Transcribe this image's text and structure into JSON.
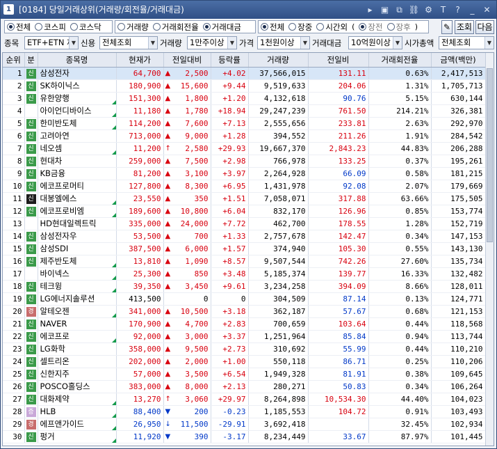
{
  "window": {
    "number": "1",
    "title": "[0184] 당일거래상위(거래량/회전율/거래대금)"
  },
  "toolbar_icons": [
    "nav-arrow-icon",
    "window-icon",
    "copy-icon",
    "link-icon",
    "settings-icon",
    "text-icon",
    "help-icon",
    "minimize-icon",
    "close-icon"
  ],
  "market_filter": {
    "options": [
      "전체",
      "코스피",
      "코스닥"
    ],
    "selected": "전체"
  },
  "sort_filter": {
    "options": [
      "거래량",
      "거래회전율",
      "거래대금"
    ],
    "selected": "거래대금"
  },
  "session_filter": {
    "options": [
      "전체",
      "장중",
      "시간외"
    ],
    "selected": "전체",
    "sub_options": [
      "장전",
      "장후"
    ]
  },
  "buttons": {
    "query": "조회",
    "next": "다음"
  },
  "filters": {
    "stock_label": "종목",
    "stock_value": "ETF+ETN 제",
    "credit_label": "신용",
    "credit_value": "전체조회",
    "volume_label": "거래량",
    "volume_value": "1만주이상",
    "price_label": "가격",
    "price_value": "1천원이상",
    "amount_label": "거래대금",
    "amount_value": "10억원이상",
    "mcap_label": "시가총액",
    "mcap_value": "전체조회"
  },
  "columns": [
    "순위",
    "분",
    "종목명",
    "현재가",
    "전일대비",
    "등락률",
    "거래량",
    "전일비",
    "거래회전율",
    "금액(백만)"
  ],
  "colors": {
    "up": "#d8000f",
    "down": "#0038c8",
    "title_bar": "#2f4f86",
    "selected_row": "#d7e6f7"
  },
  "rows": [
    {
      "rank": "1",
      "badge": "신",
      "bc": "g",
      "name": "삼성전자",
      "flag": false,
      "price": "64,700",
      "dir": "up",
      "arrow": "▲",
      "change": "2,500",
      "rate": "+4.02",
      "volume": "37,566,015",
      "prev_ratio": "131.11",
      "pr_dir": "up",
      "turnover": "0.63%",
      "amount": "2,417,513"
    },
    {
      "rank": "2",
      "badge": "신",
      "bc": "g",
      "name": "SK하이닉스",
      "flag": false,
      "price": "180,900",
      "dir": "up",
      "arrow": "▲",
      "change": "15,600",
      "rate": "+9.44",
      "volume": "9,519,633",
      "prev_ratio": "204.06",
      "pr_dir": "up",
      "turnover": "1.31%",
      "amount": "1,705,713"
    },
    {
      "rank": "3",
      "badge": "신",
      "bc": "g",
      "name": "유한양행",
      "flag": true,
      "price": "151,300",
      "dir": "up",
      "arrow": "▲",
      "change": "1,800",
      "rate": "+1.20",
      "volume": "4,132,618",
      "prev_ratio": "90.76",
      "pr_dir": "dn",
      "turnover": "5.15%",
      "amount": "630,144"
    },
    {
      "rank": "4",
      "badge": "",
      "bc": "",
      "name": "아이언디바이스",
      "flag": true,
      "price": "11,180",
      "dir": "up",
      "arrow": "▲",
      "change": "1,780",
      "rate": "+18.94",
      "volume": "29,247,239",
      "prev_ratio": "761.50",
      "pr_dir": "up",
      "turnover": "214.21%",
      "amount": "326,381"
    },
    {
      "rank": "5",
      "badge": "신",
      "bc": "g",
      "name": "한미반도체",
      "flag": true,
      "price": "114,200",
      "dir": "up",
      "arrow": "▲",
      "change": "7,600",
      "rate": "+7.13",
      "volume": "2,555,656",
      "prev_ratio": "233.81",
      "pr_dir": "up",
      "turnover": "2.63%",
      "amount": "292,970"
    },
    {
      "rank": "6",
      "badge": "신",
      "bc": "g",
      "name": "고려아연",
      "flag": false,
      "price": "713,000",
      "dir": "up",
      "arrow": "▲",
      "change": "9,000",
      "rate": "+1.28",
      "volume": "394,552",
      "prev_ratio": "211.26",
      "pr_dir": "up",
      "turnover": "1.91%",
      "amount": "284,542"
    },
    {
      "rank": "7",
      "badge": "신",
      "bc": "g",
      "name": "네오셈",
      "flag": true,
      "price": "11,200",
      "dir": "up",
      "arrow": "↑",
      "change": "2,580",
      "rate": "+29.93",
      "volume": "19,667,370",
      "prev_ratio": "2,843.23",
      "pr_dir": "up",
      "turnover": "44.83%",
      "amount": "206,288"
    },
    {
      "rank": "8",
      "badge": "신",
      "bc": "g",
      "name": "현대차",
      "flag": false,
      "price": "259,000",
      "dir": "up",
      "arrow": "▲",
      "change": "7,500",
      "rate": "+2.98",
      "volume": "766,978",
      "prev_ratio": "133.25",
      "pr_dir": "up",
      "turnover": "0.37%",
      "amount": "195,261"
    },
    {
      "rank": "9",
      "badge": "신",
      "bc": "g",
      "name": "KB금융",
      "flag": false,
      "price": "81,200",
      "dir": "up",
      "arrow": "▲",
      "change": "3,100",
      "rate": "+3.97",
      "volume": "2,264,928",
      "prev_ratio": "66.09",
      "pr_dir": "dn",
      "turnover": "0.58%",
      "amount": "181,215"
    },
    {
      "rank": "10",
      "badge": "신",
      "bc": "g",
      "name": "에코프로머티",
      "flag": false,
      "price": "127,800",
      "dir": "up",
      "arrow": "▲",
      "change": "8,300",
      "rate": "+6.95",
      "volume": "1,431,978",
      "prev_ratio": "92.08",
      "pr_dir": "dn",
      "turnover": "2.07%",
      "amount": "179,669"
    },
    {
      "rank": "11",
      "badge": "신",
      "bc": "k",
      "name": "대봉엘에스",
      "flag": true,
      "price": "23,550",
      "dir": "up",
      "arrow": "▲",
      "change": "350",
      "rate": "+1.51",
      "volume": "7,058,071",
      "prev_ratio": "317.88",
      "pr_dir": "up",
      "turnover": "63.66%",
      "amount": "175,505"
    },
    {
      "rank": "12",
      "badge": "신",
      "bc": "g",
      "name": "에코프로비엠",
      "flag": true,
      "price": "189,600",
      "dir": "up",
      "arrow": "▲",
      "change": "10,800",
      "rate": "+6.04",
      "volume": "832,170",
      "prev_ratio": "126.96",
      "pr_dir": "up",
      "turnover": "0.85%",
      "amount": "153,774"
    },
    {
      "rank": "13",
      "badge": "",
      "bc": "",
      "name": "HD현대일렉트릭",
      "flag": false,
      "price": "335,000",
      "dir": "up",
      "arrow": "▲",
      "change": "24,000",
      "rate": "+7.72",
      "volume": "462,700",
      "prev_ratio": "178.55",
      "pr_dir": "up",
      "turnover": "1.28%",
      "amount": "152,719"
    },
    {
      "rank": "14",
      "badge": "신",
      "bc": "g",
      "name": "삼성전자우",
      "flag": false,
      "price": "53,500",
      "dir": "up",
      "arrow": "▲",
      "change": "700",
      "rate": "+1.33",
      "volume": "2,757,678",
      "prev_ratio": "142.47",
      "pr_dir": "up",
      "turnover": "0.34%",
      "amount": "147,153"
    },
    {
      "rank": "15",
      "badge": "신",
      "bc": "g",
      "name": "삼성SDI",
      "flag": false,
      "price": "387,500",
      "dir": "up",
      "arrow": "▲",
      "change": "6,000",
      "rate": "+1.57",
      "volume": "374,940",
      "prev_ratio": "105.30",
      "pr_dir": "up",
      "turnover": "0.55%",
      "amount": "143,130"
    },
    {
      "rank": "16",
      "badge": "신",
      "bc": "g",
      "name": "제주반도체",
      "flag": true,
      "price": "13,810",
      "dir": "up",
      "arrow": "▲",
      "change": "1,090",
      "rate": "+8.57",
      "volume": "9,507,544",
      "prev_ratio": "742.26",
      "pr_dir": "up",
      "turnover": "27.60%",
      "amount": "135,734"
    },
    {
      "rank": "17",
      "badge": "",
      "bc": "",
      "name": "바이넥스",
      "flag": true,
      "price": "25,300",
      "dir": "up",
      "arrow": "▲",
      "change": "850",
      "rate": "+3.48",
      "volume": "5,185,374",
      "prev_ratio": "139.77",
      "pr_dir": "up",
      "turnover": "16.33%",
      "amount": "132,482"
    },
    {
      "rank": "18",
      "badge": "신",
      "bc": "g",
      "name": "테크윙",
      "flag": true,
      "price": "39,350",
      "dir": "up",
      "arrow": "▲",
      "change": "3,450",
      "rate": "+9.61",
      "volume": "3,234,258",
      "prev_ratio": "394.09",
      "pr_dir": "up",
      "turnover": "8.66%",
      "amount": "128,011"
    },
    {
      "rank": "19",
      "badge": "신",
      "bc": "g",
      "name": "LG에너지솔루션",
      "flag": false,
      "price": "413,500",
      "dir": "flat",
      "arrow": "",
      "change": "0",
      "rate": "0",
      "volume": "304,509",
      "prev_ratio": "87.14",
      "pr_dir": "dn",
      "turnover": "0.13%",
      "amount": "124,771"
    },
    {
      "rank": "20",
      "badge": "경",
      "bc": "r",
      "name": "알테오젠",
      "flag": true,
      "price": "341,000",
      "dir": "up",
      "arrow": "▲",
      "change": "10,500",
      "rate": "+3.18",
      "volume": "362,187",
      "prev_ratio": "57.67",
      "pr_dir": "dn",
      "turnover": "0.68%",
      "amount": "121,153"
    },
    {
      "rank": "21",
      "badge": "신",
      "bc": "g",
      "name": "NAVER",
      "flag": false,
      "price": "170,900",
      "dir": "up",
      "arrow": "▲",
      "change": "4,700",
      "rate": "+2.83",
      "volume": "700,659",
      "prev_ratio": "103.64",
      "pr_dir": "up",
      "turnover": "0.44%",
      "amount": "118,568"
    },
    {
      "rank": "22",
      "badge": "신",
      "bc": "g",
      "name": "에코프로",
      "flag": true,
      "price": "92,000",
      "dir": "up",
      "arrow": "▲",
      "change": "3,000",
      "rate": "+3.37",
      "volume": "1,251,964",
      "prev_ratio": "85.84",
      "pr_dir": "dn",
      "turnover": "0.94%",
      "amount": "113,744"
    },
    {
      "rank": "23",
      "badge": "신",
      "bc": "g",
      "name": "LG화학",
      "flag": false,
      "price": "358,000",
      "dir": "up",
      "arrow": "▲",
      "change": "9,500",
      "rate": "+2.73",
      "volume": "310,692",
      "prev_ratio": "55.99",
      "pr_dir": "dn",
      "turnover": "0.44%",
      "amount": "110,210"
    },
    {
      "rank": "24",
      "badge": "신",
      "bc": "g",
      "name": "셀트리온",
      "flag": false,
      "price": "202,000",
      "dir": "up",
      "arrow": "▲",
      "change": "2,000",
      "rate": "+1.00",
      "volume": "550,118",
      "prev_ratio": "86.71",
      "pr_dir": "dn",
      "turnover": "0.25%",
      "amount": "110,206"
    },
    {
      "rank": "25",
      "badge": "신",
      "bc": "g",
      "name": "신한지주",
      "flag": false,
      "price": "57,000",
      "dir": "up",
      "arrow": "▲",
      "change": "3,500",
      "rate": "+6.54",
      "volume": "1,949,328",
      "prev_ratio": "81.91",
      "pr_dir": "dn",
      "turnover": "0.38%",
      "amount": "109,645"
    },
    {
      "rank": "26",
      "badge": "신",
      "bc": "g",
      "name": "POSCO홀딩스",
      "flag": false,
      "price": "383,000",
      "dir": "up",
      "arrow": "▲",
      "change": "8,000",
      "rate": "+2.13",
      "volume": "280,271",
      "prev_ratio": "50.83",
      "pr_dir": "dn",
      "turnover": "0.34%",
      "amount": "106,264"
    },
    {
      "rank": "27",
      "badge": "신",
      "bc": "g",
      "name": "대화제약",
      "flag": true,
      "price": "13,270",
      "dir": "up",
      "arrow": "↑",
      "change": "3,060",
      "rate": "+29.97",
      "volume": "8,264,898",
      "prev_ratio": "10,534.30",
      "pr_dir": "up",
      "turnover": "44.40%",
      "amount": "104,023"
    },
    {
      "rank": "28",
      "badge": "증",
      "bc": "p",
      "name": "HLB",
      "flag": true,
      "price": "88,400",
      "dir": "dn",
      "arrow": "▼",
      "change": "200",
      "rate": "-0.23",
      "volume": "1,185,553",
      "prev_ratio": "104.72",
      "pr_dir": "up",
      "turnover": "0.91%",
      "amount": "103,493"
    },
    {
      "rank": "29",
      "badge": "경",
      "bc": "r",
      "name": "에프앤가이드",
      "flag": true,
      "price": "26,950",
      "dir": "dn",
      "arrow": "↓",
      "change": "11,500",
      "rate": "-29.91",
      "volume": "3,692,418",
      "prev_ratio": "",
      "pr_dir": "up",
      "turnover": "32.45%",
      "amount": "102,934"
    },
    {
      "rank": "30",
      "badge": "신",
      "bc": "g",
      "name": "펑거",
      "flag": true,
      "price": "11,920",
      "dir": "dn",
      "arrow": "▼",
      "change": "390",
      "rate": "-3.17",
      "volume": "8,234,449",
      "prev_ratio": "33.67",
      "pr_dir": "dn",
      "turnover": "87.97%",
      "amount": "101,445"
    }
  ]
}
